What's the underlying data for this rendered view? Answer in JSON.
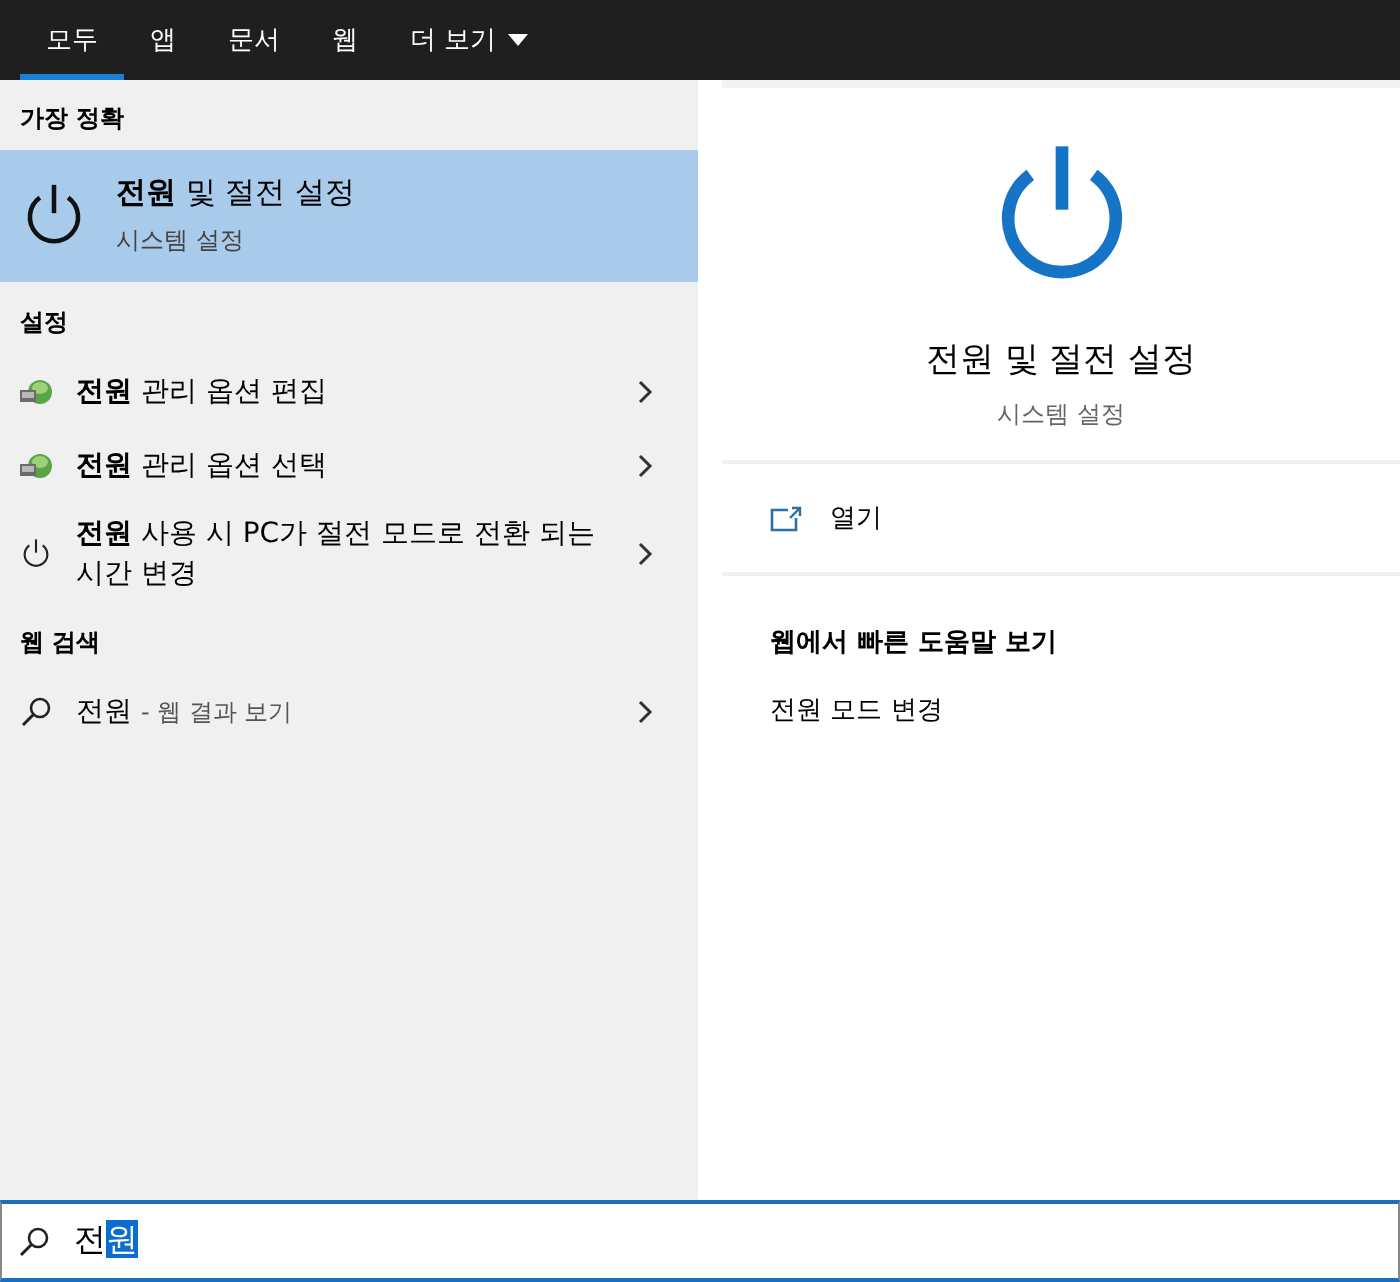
{
  "tabs": [
    {
      "label": "모두",
      "selected": true,
      "kind": "plain"
    },
    {
      "label": "앱",
      "selected": false,
      "kind": "plain"
    },
    {
      "label": "문서",
      "selected": false,
      "kind": "plain"
    },
    {
      "label": "웹",
      "selected": false,
      "kind": "plain"
    },
    {
      "label": "더 보기",
      "selected": false,
      "kind": "dropdown"
    }
  ],
  "best_match": {
    "heading": "가장 정확",
    "title": "**전원** 및 절전 설정",
    "subtitle": "시스템 설정",
    "selected": true
  },
  "settings": {
    "heading": "설정",
    "items": [
      {
        "kind": "control-panel",
        "text": "**전원** 관리 옵션 편집"
      },
      {
        "kind": "control-panel",
        "text": "**전원** 관리 옵션 선택"
      },
      {
        "kind": "power",
        "text": "**전원** 사용 시 PC가 절전 모드로 전환 되는 시간 변경"
      }
    ]
  },
  "web_search": {
    "heading": "웹 검색",
    "query": "전원",
    "hint": "- 웹 결과 보기"
  },
  "preview": {
    "title": "전원 및 절전 설정",
    "subtitle": "시스템 설정",
    "actions": [
      {
        "label": "열기"
      }
    ],
    "help_heading": "웹에서 빠른 도움말 보기",
    "help_links": [
      "전원 모드 변경"
    ]
  },
  "search": {
    "text": "전",
    "highlighted_text": "원"
  }
}
